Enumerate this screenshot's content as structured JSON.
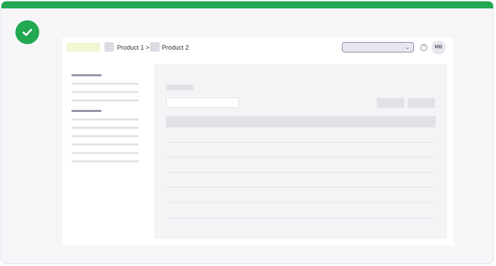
{
  "breadcrumb": {
    "item1": "Product 1 >",
    "item2": "Product 2"
  },
  "header": {
    "select_value": "",
    "help_glyph": "?",
    "avatar_initials": "MB"
  },
  "colors": {
    "success": "#21a851",
    "panel": "#f4f4f6",
    "placeholder": "#e1e2e7"
  }
}
